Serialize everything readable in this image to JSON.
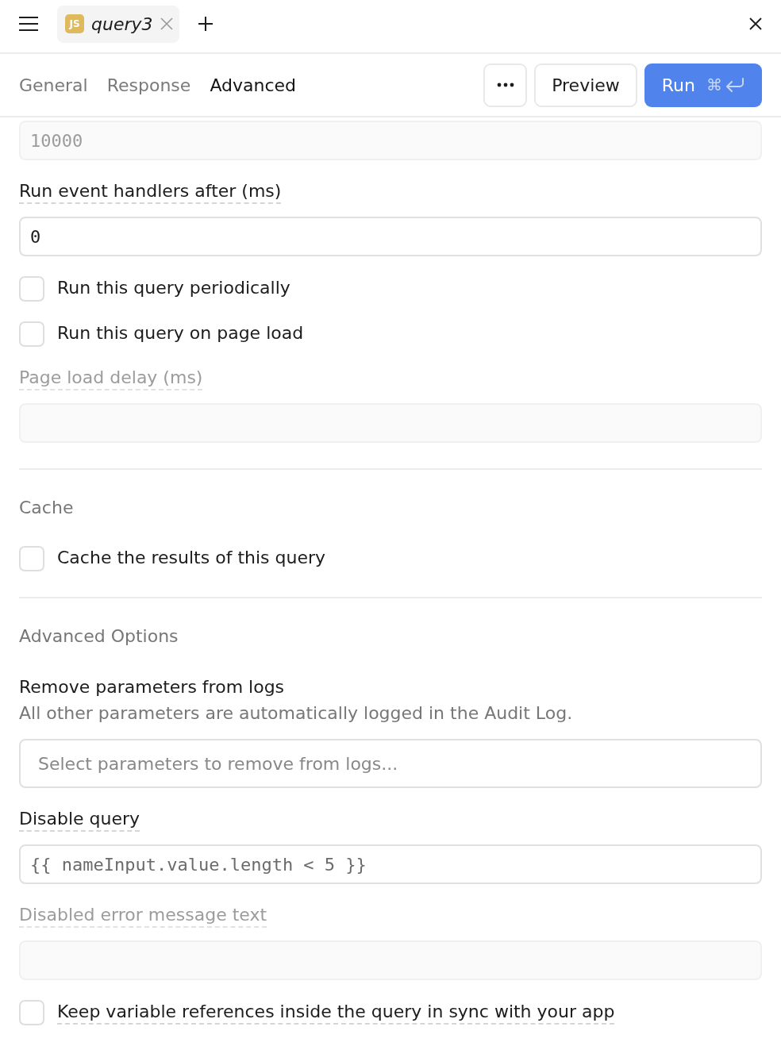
{
  "file_tabs": [
    {
      "badge": "JS",
      "title": "query3",
      "selected": true
    }
  ],
  "section_tabs": [
    {
      "label": "General",
      "selected": false
    },
    {
      "label": "Response",
      "selected": false
    },
    {
      "label": "Advanced",
      "selected": true
    }
  ],
  "actions": {
    "preview": "Preview",
    "run": "Run",
    "run_shortcut": "⌘"
  },
  "sections": [
    {
      "items": [
        {
          "kind": "input",
          "value": "10000",
          "disabled": true
        },
        {
          "kind": "input",
          "label": "Run event handlers after (ms)",
          "has_tooltip": true,
          "value": "0",
          "disabled": false
        },
        {
          "kind": "checkbox",
          "label": "Run this query periodically",
          "has_tooltip": false,
          "checked": false
        },
        {
          "kind": "checkbox",
          "label": "Run this query on page load",
          "has_tooltip": false,
          "checked": false
        },
        {
          "kind": "input",
          "label": "Page load delay (ms)",
          "has_tooltip": true,
          "disabled": true
        }
      ]
    },
    {
      "heading": "Cache",
      "items": [
        {
          "kind": "checkbox",
          "label": "Cache the results of this query",
          "has_tooltip": false,
          "checked": false
        }
      ]
    },
    {
      "heading": "Advanced Options",
      "items": [
        {
          "kind": "select",
          "label": "Remove parameters from logs",
          "has_tooltip": false,
          "description": "All other parameters are automatically logged in the Audit Log.",
          "placeholder": "Select parameters to remove from logs..."
        },
        {
          "kind": "code",
          "label": "Disable query",
          "has_tooltip": true,
          "value": "{{ nameInput.value.length < 5 }}",
          "disabled": false
        },
        {
          "kind": "input",
          "label": "Disabled error message text",
          "has_tooltip": true,
          "disabled": true
        },
        {
          "kind": "checkbox",
          "label": "Keep variable references inside the query in sync with your app",
          "has_tooltip": true,
          "checked": false
        }
      ]
    }
  ]
}
